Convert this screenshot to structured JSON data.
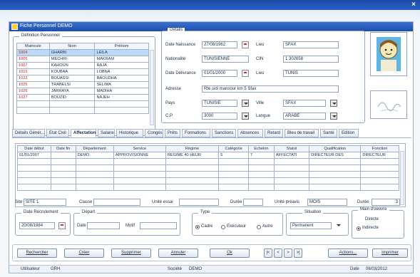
{
  "window_title": "Fiche Personnel   DEMO",
  "close_glyph": "×",
  "identification": {
    "legend": "Définition Personnel",
    "columns": [
      "Matricule",
      "Nom",
      "Prénom"
    ],
    "rows": [
      [
        "1004",
        "GHARBI",
        "LEILA"
      ],
      [
        "1005",
        "MECHRI",
        "MAKRAM"
      ],
      [
        "1007",
        "KAHOUN",
        "RAJA"
      ],
      [
        "1015",
        "KOUBAA",
        "LOBNA"
      ],
      [
        "1022",
        "BOUASSI",
        "RAOUDHA"
      ],
      [
        "1025",
        "TRABELSI",
        "SELIMA"
      ],
      [
        "1026",
        "JARRAYA",
        "MADIHA"
      ],
      [
        "1027",
        "BOUZID",
        "NAJEH"
      ]
    ]
  },
  "details": {
    "legend": "Détails",
    "date_naissance_label": "Date Naissance",
    "date_naissance": "27/08/1962",
    "lieu_label": "Lieu",
    "lieu": "SFAX",
    "nationalite_label": "Nationalité",
    "nationalite": "TUNISIENNE",
    "cin_label": "CIN",
    "cin": "1 302658",
    "date_delivrance_label": "Date Délivrance",
    "date_delivrance": "01/01/2000",
    "lieu2_label": "Lieu",
    "lieu2": "TUNIS",
    "adresse_label": "Adresse",
    "adresse": "Rte sidi mansour km 5 Sfax",
    "pays_label": "Pays",
    "pays": "TUNISIE",
    "ville_label": "Ville",
    "ville": "SFAX",
    "cp_label": "C.P",
    "cp": "3000",
    "langue_label": "Langue",
    "langue": "ARABE"
  },
  "tabs": [
    "Détails Génér...",
    "Etat Civil",
    "Affectation",
    "Salaire",
    "Historique",
    "Congés",
    "Prêts",
    "Formations",
    "Sanctions",
    "Absences",
    "Retard",
    "Bleu de travail",
    "Santé",
    "Edition"
  ],
  "active_tab": "Affectation",
  "affectation_table": {
    "columns": [
      "Date début",
      "Date fin",
      "Département",
      "Service",
      "Régime",
      "Catégorie",
      "Echelon",
      "Statut",
      "Qualification",
      "Fonction"
    ],
    "rows": [
      [
        "01/01/2007",
        "",
        "DEMO",
        "APPROVISIONNE",
        "REGIME 40 HEUR",
        "5",
        "7",
        "AFFECTATI",
        "DIRECTEUR DES",
        "DIRECTEUR"
      ]
    ]
  },
  "site_label": "Site",
  "site": "SITE 1",
  "classe_label": "Classe",
  "classe": "",
  "unite_essai_label": "Unité essai",
  "unite_essai": "",
  "duree_label": "Durée",
  "duree": "",
  "unite_preavis_label": "Unité préavis",
  "unite_preavis": "MOIS",
  "duree2_label": "Durée",
  "duree2": "3",
  "date_recrutement_legend": "Date Recrutement",
  "date_recrutement": "20/08/1984",
  "depart_legend": "Départ",
  "depart_date_label": "Date",
  "depart_date": "",
  "motif_label": "Motif",
  "motif": "",
  "type_legend": "Type",
  "type_options": [
    "Cadre",
    "Exécuteur",
    "Autre"
  ],
  "type_selected": "Cadre",
  "situation_legend": "Situation",
  "situation": "Permanent",
  "main_oeuvre_legend": "Main d'oeuvre",
  "main_oeuvre_options": [
    "Directe",
    "Indirecte"
  ],
  "main_oeuvre_selected": "Indirecte",
  "buttons": {
    "rechercher": "Rechercher",
    "creer": "Créer",
    "supprimer": "Supprimer",
    "annuler": "Annuler",
    "ok": "Ok",
    "first": "|<",
    "prev": "<",
    "next": ">",
    "last": ">|",
    "actions": "Actions...",
    "imprimer": "Imprimer"
  },
  "status": {
    "utilisateur_label": "Utilisateur",
    "utilisateur": "GRH",
    "societe_label": "Société",
    "societe": "DEMO",
    "date_label": "Date",
    "date": "06/03/2012"
  },
  "colors": {
    "title_bar": "#1e4ea9",
    "selected_row": "#bcd9f6",
    "matricule": "#c62020"
  }
}
